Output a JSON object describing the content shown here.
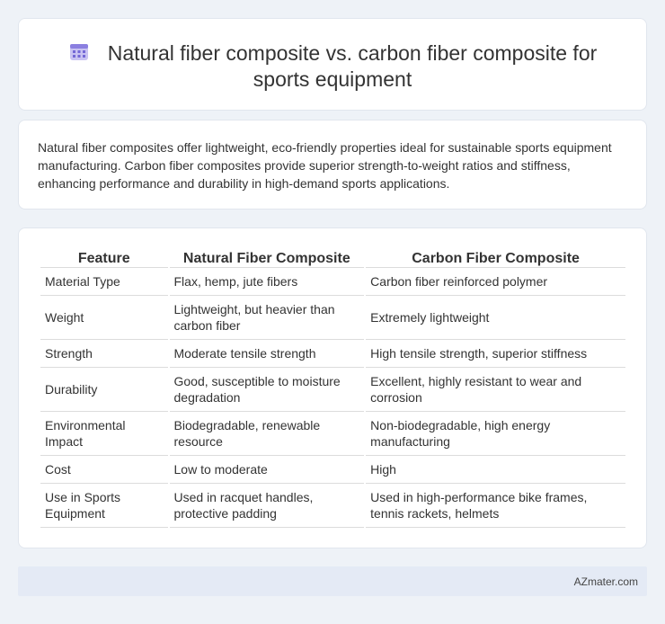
{
  "header": {
    "title": "Natural fiber composite vs. carbon fiber composite for sports equipment",
    "icon": "calendar-icon"
  },
  "intro": {
    "text": "Natural fiber composites offer lightweight, eco-friendly properties ideal for sustainable sports equipment manufacturing. Carbon fiber composites provide superior strength-to-weight ratios and stiffness, enhancing performance and durability in high-demand sports applications."
  },
  "table": {
    "headers": [
      "Feature",
      "Natural Fiber Composite",
      "Carbon Fiber Composite"
    ],
    "rows": [
      [
        "Material Type",
        "Flax, hemp, jute fibers",
        "Carbon fiber reinforced polymer"
      ],
      [
        "Weight",
        "Lightweight, but heavier than carbon fiber",
        "Extremely lightweight"
      ],
      [
        "Strength",
        "Moderate tensile strength",
        "High tensile strength, superior stiffness"
      ],
      [
        "Durability",
        "Good, susceptible to moisture degradation",
        "Excellent, highly resistant to wear and corrosion"
      ],
      [
        "Environmental Impact",
        "Biodegradable, renewable resource",
        "Non-biodegradable, high energy manufacturing"
      ],
      [
        "Cost",
        "Low to moderate",
        "High"
      ],
      [
        "Use in Sports Equipment",
        "Used in racquet handles, protective padding",
        "Used in high-performance bike frames, tennis rackets, helmets"
      ]
    ]
  },
  "footer": {
    "brand": "AZmater.com"
  }
}
